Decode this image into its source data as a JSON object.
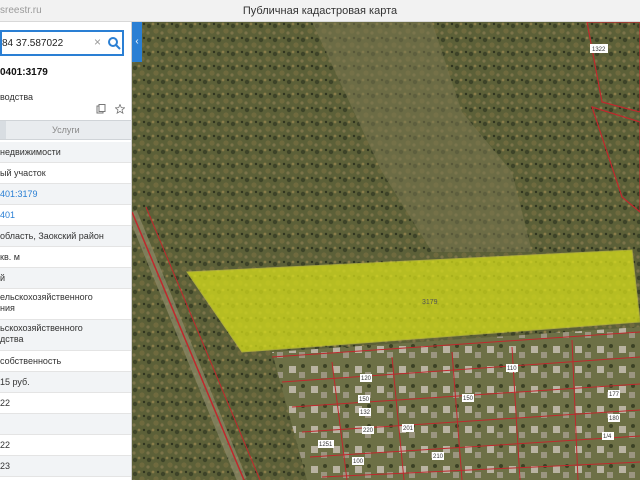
{
  "browser": {
    "url_fragment": "sreestr.ru",
    "title": "Публичная кадастровая карта"
  },
  "search": {
    "value": "84 37.587022",
    "clear_glyph": "×"
  },
  "object": {
    "number": "0401:3179",
    "type": "водства"
  },
  "tabs": {
    "services": "Услуги"
  },
  "rows": [
    {
      "text": "недвижимости"
    },
    {
      "text": "ый участок"
    },
    {
      "text": "401:3179",
      "link": true
    },
    {
      "text": "401",
      "link": true
    },
    {
      "text": "область, Заокский район"
    },
    {
      "text": "кв. м"
    },
    {
      "text": "й"
    },
    {
      "text": "ельскохозяйственного\nния",
      "two": true
    },
    {
      "text": "ьскохозяйственного\nдства",
      "two": true
    },
    {
      "text": "собственность"
    },
    {
      "text": "15 руб."
    },
    {
      "text": "22"
    },
    {
      "text": ""
    },
    {
      "text": "22"
    },
    {
      "text": "23"
    }
  ],
  "map": {
    "parcel_label": "3179",
    "plot_numbers": [
      "1322",
      "120",
      "150",
      "132",
      "220",
      "201",
      "210",
      "1251",
      "100",
      "177",
      "180",
      "1/4",
      "110",
      "150"
    ]
  },
  "colors": {
    "accent": "#2a7fd4",
    "parcel_fill": "#d9e21a",
    "boundary": "#c0282d"
  }
}
